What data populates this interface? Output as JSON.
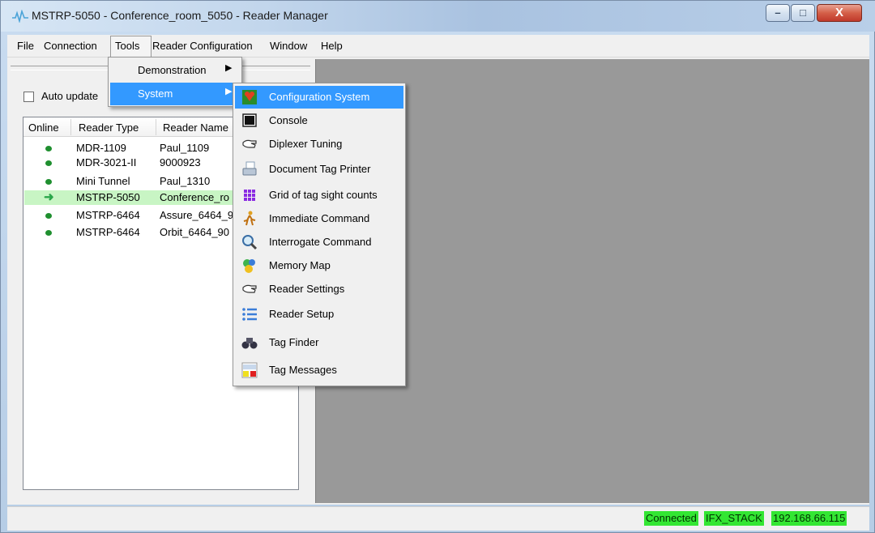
{
  "window": {
    "title": "MSTRP-5050 - Conference_room_5050 - Reader Manager",
    "controls": {
      "minimize": "–",
      "maximize": "□",
      "close": "X"
    }
  },
  "menubar": {
    "items": [
      "File",
      "Connection",
      "Tools",
      "Reader Configuration",
      "Window",
      "Help"
    ]
  },
  "tools_menu": {
    "items": [
      {
        "label": "Demonstration",
        "has_submenu": true,
        "highlighted": false
      },
      {
        "label": "System",
        "has_submenu": true,
        "highlighted": true
      }
    ]
  },
  "system_menu": {
    "items": [
      {
        "label": "Configuration System",
        "icon": "configuration-icon",
        "highlighted": true
      },
      {
        "label": "Console",
        "icon": "console-icon"
      },
      {
        "label": "Diplexer Tuning",
        "icon": "hand-pointer-icon"
      },
      {
        "label": "Document Tag Printer",
        "icon": "printer-icon"
      },
      {
        "label": "Grid of tag sight counts",
        "icon": "grid-icon"
      },
      {
        "label": "Immediate Command",
        "icon": "running-man-icon"
      },
      {
        "label": "Interrogate Command",
        "icon": "magnifier-icon"
      },
      {
        "label": "Memory Map",
        "icon": "memory-map-icon"
      },
      {
        "label": "Reader Settings",
        "icon": "hand-pointer-icon"
      },
      {
        "label": "Reader Setup",
        "icon": "list-icon"
      },
      {
        "label": "Tag Finder",
        "icon": "binoculars-icon"
      },
      {
        "label": "Tag Messages",
        "icon": "tag-messages-icon"
      }
    ]
  },
  "left_panel": {
    "auto_update_label": "Auto update",
    "auto_update_checked": false,
    "columns": [
      "Online",
      "Reader Type",
      "Reader Name"
    ],
    "rows": [
      {
        "status": "online",
        "type": "MDR-1109",
        "name": "Paul_1109",
        "selected": false
      },
      {
        "status": "online",
        "type": "MDR-3021-II",
        "name": "9000923",
        "selected": false
      },
      {
        "status": "online",
        "type": "Mini Tunnel",
        "name": "Paul_1310",
        "selected": false
      },
      {
        "status": "active",
        "type": "MSTRP-5050",
        "name": "Conference_ro",
        "selected": true
      },
      {
        "status": "online",
        "type": "MSTRP-6464",
        "name": "Assure_6464_9",
        "selected": false
      },
      {
        "status": "online",
        "type": "MSTRP-6464",
        "name": "Orbit_6464_90",
        "selected": false
      }
    ]
  },
  "statusbar": {
    "connection": "Connected",
    "stack": "IFX_STACK",
    "ip": "192.168.66.115",
    "status_color": "#33e633"
  },
  "colors": {
    "highlight": "#3399ff",
    "selected_row": "#c8f5c4",
    "workspace": "#999999"
  }
}
